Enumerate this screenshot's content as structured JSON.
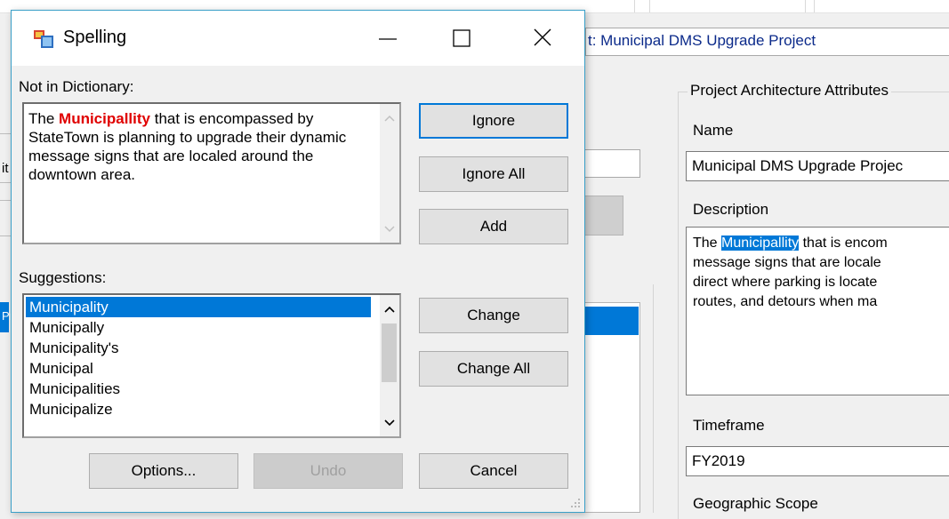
{
  "background": {
    "project_title_field": "t: Municipal DMS Upgrade Project",
    "left_edge_glyph": "it",
    "left_list_glyph": "Pr",
    "architecture_group": {
      "legend": "Project Architecture Attributes",
      "name_label": "Name",
      "name_value": "Municipal DMS Upgrade Projec",
      "description_label": "Description",
      "description_lines": [
        {
          "before": "The ",
          "highlight": "Municipallity",
          "after": " that is encom"
        },
        {
          "before": "message signs that are locale",
          "highlight": "",
          "after": ""
        },
        {
          "before": "direct where parking is locate",
          "highlight": "",
          "after": ""
        },
        {
          "before": "routes, and detours when ma",
          "highlight": "",
          "after": ""
        }
      ],
      "timeframe_label": "Timeframe",
      "timeframe_value": "FY2019",
      "geographic_scope_label": "Geographic Scope"
    }
  },
  "dialog": {
    "title": "Spelling",
    "caption_buttons": {
      "minimize": "minimize-icon",
      "maximize": "maximize-icon",
      "close": "close-icon"
    },
    "not_in_dictionary_label": "Not in Dictionary:",
    "sentence": {
      "before": "The ",
      "misspelled": "Municipallity",
      "after": " that is encompassed by StateTown is planning to upgrade their dynamic message signs that are localed around the downtown area."
    },
    "suggestions_label": "Suggestions:",
    "suggestions": [
      "Municipality",
      "Municipally",
      "Municipality's",
      "Municipal",
      "Municipalities",
      "Municipalize"
    ],
    "selected_suggestion_index": 0,
    "buttons": {
      "ignore": "Ignore",
      "ignore_all": "Ignore All",
      "add": "Add",
      "change": "Change",
      "change_all": "Change All",
      "options": "Options...",
      "undo": "Undo",
      "cancel": "Cancel"
    }
  },
  "colors": {
    "selection": "#0078d7",
    "misspelled_word": "#e00000",
    "dialog_border": "#3aa0c8",
    "title_link_text": "#0b2a8a"
  }
}
